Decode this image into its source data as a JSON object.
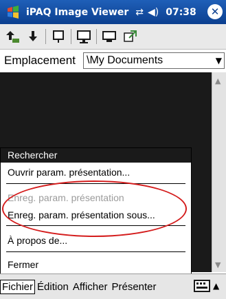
{
  "titlebar": {
    "title": "iPAQ Image Viewer",
    "time": "07:38",
    "icons": [
      "start-menu-icon",
      "connectivity-icon",
      "volume-icon",
      "close-icon"
    ],
    "close_label": "✕"
  },
  "toolbar": {
    "icons": [
      "up-folder-icon",
      "download-icon",
      "slideshow-icon",
      "display-icon",
      "monitor-icon",
      "export-icon"
    ]
  },
  "location": {
    "label": "Emplacement",
    "value": "\\My Documents"
  },
  "menu": {
    "header": "Rechercher",
    "items": {
      "open_presentation_settings": "Ouvrir param. présentation...",
      "save_presentation_settings": "Enreg. param. présentation",
      "save_presentation_settings_as": "Enreg. param. présentation sous...",
      "about": "À propos de...",
      "close": "Fermer"
    }
  },
  "menubar": {
    "file": "Fichier",
    "edit": "Édition",
    "view": "Afficher",
    "present": "Présenter"
  },
  "colors": {
    "titlebar": "#0b3f8f",
    "highlight_ellipse": "#d41c1c",
    "viewer_bg": "#1a1a1a"
  }
}
